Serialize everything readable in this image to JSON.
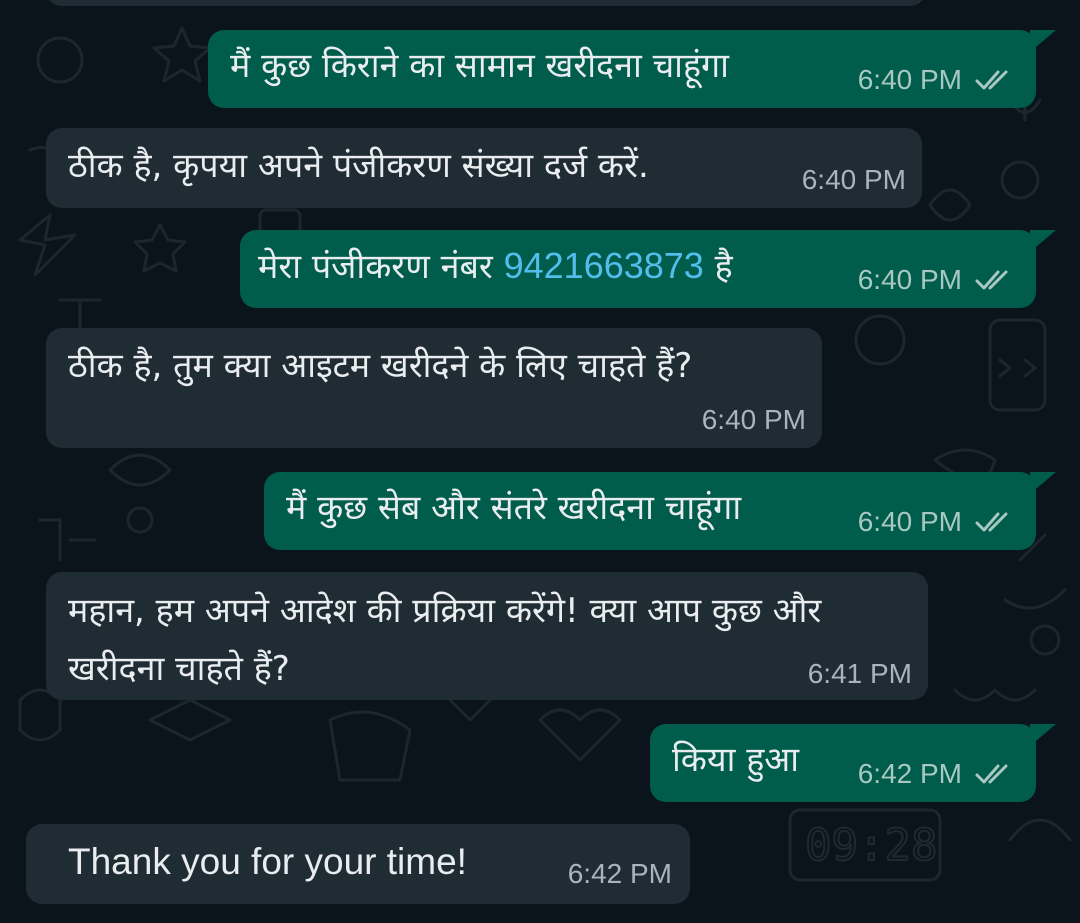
{
  "chat": {
    "messages": [
      {
        "direction": "outgoing",
        "text": "मैं कुछ किराने का सामान खरीदना चाहूंगा",
        "time": "6:40 PM",
        "status": "read"
      },
      {
        "direction": "incoming",
        "text": "ठीक है, कृपया अपने पंजीकरण संख्या दर्ज करें.",
        "time": "6:40 PM"
      },
      {
        "direction": "outgoing",
        "text_before": "मेरा पंजीकरण नंबर ",
        "phone_link": "9421663873",
        "text_after": " है",
        "time": "6:40 PM",
        "status": "read"
      },
      {
        "direction": "incoming",
        "text": "ठीक है, तुम क्या आइटम खरीदने के लिए चाहते हैं?",
        "time": "6:40 PM"
      },
      {
        "direction": "outgoing",
        "text": "मैं कुछ सेब और संतरे खरीदना चाहूंगा",
        "time": "6:40 PM",
        "status": "read"
      },
      {
        "direction": "incoming",
        "text": "महान, हम अपने आदेश की प्रक्रिया करेंगे! क्या आप कुछ और खरीदना चाहते हैं?",
        "time": "6:41 PM"
      },
      {
        "direction": "outgoing",
        "text": "किया हुआ",
        "time": "6:42 PM",
        "status": "read"
      },
      {
        "direction": "incoming",
        "text": "Thank you for your time!",
        "time": "6:42 PM"
      }
    ]
  },
  "colors": {
    "background": "#0b141a",
    "incoming_bubble": "#202c33",
    "outgoing_bubble": "#005c4b",
    "link": "#53bdeb",
    "read_tick": "#a7c9c1"
  },
  "icons": {
    "read_receipt": "double-check-icon",
    "wallpaper": "doodle-pattern"
  }
}
